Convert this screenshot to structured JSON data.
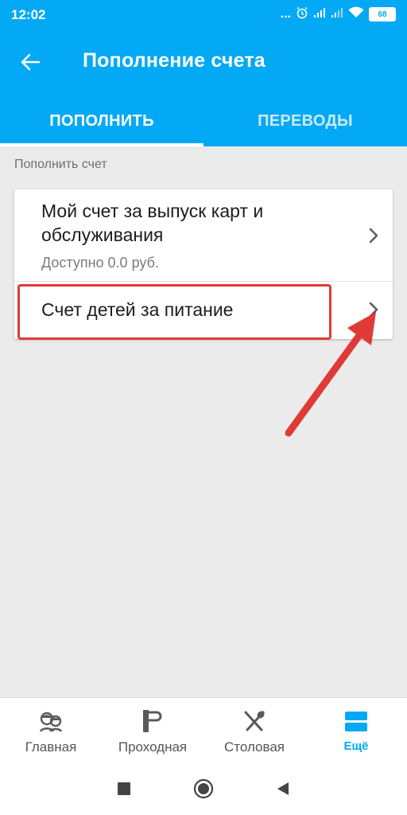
{
  "status_bar": {
    "time": "12:02",
    "dots": "...",
    "battery": "68"
  },
  "app_bar": {
    "title": "Пополнение счета"
  },
  "tabs": [
    {
      "label": "ПОПОЛНИТЬ",
      "active": true
    },
    {
      "label": "ПЕРЕВОДЫ",
      "active": false
    }
  ],
  "section": {
    "caption": "Пополнить счет"
  },
  "accounts": [
    {
      "title": "Мой счет за выпуск карт и обслуживания",
      "subtitle": "Доступно 0.0 руб."
    },
    {
      "title": "Счет детей за питание"
    }
  ],
  "bottom_nav": [
    {
      "label": "Главная",
      "icon": "kids-icon"
    },
    {
      "label": "Проходная",
      "icon": "turnstile-icon"
    },
    {
      "label": "Столовая",
      "icon": "cutlery-icon"
    },
    {
      "label": "Ещё",
      "icon": "menu-icon",
      "active": true
    }
  ],
  "colors": {
    "primary": "#03a9f4",
    "annotation": "#e03a36",
    "background": "#ebebeb"
  }
}
